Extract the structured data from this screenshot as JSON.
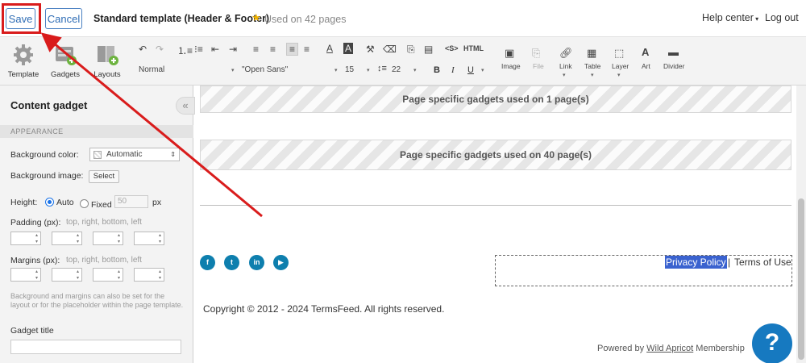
{
  "topbar": {
    "save_label": "Save",
    "cancel_label": "Cancel",
    "template_title": "Standard template (Header & Footer)",
    "used_on": "Used on 42 pages",
    "help_center": "Help center",
    "log_out": "Log out"
  },
  "toolbar": {
    "template": "Template",
    "gadgets": "Gadgets",
    "layouts": "Layouts",
    "format_value": "Normal",
    "font_value": "\"Open Sans\"",
    "font_size_value": "15",
    "line_height_value": "22",
    "source_label": "<S>",
    "html_label": "HTML",
    "image": "Image",
    "file": "File",
    "link": "Link",
    "table": "Table",
    "layer": "Layer",
    "art": "Art",
    "divider": "Divider"
  },
  "panel": {
    "title": "Content gadget",
    "section": "APPEARANCE",
    "bg_color_label": "Background color:",
    "bg_color_value": "Automatic",
    "bg_image_label": "Background image:",
    "select_label": "Select",
    "height_label": "Height:",
    "auto_label": "Auto",
    "fixed_label": "Fixed",
    "fixed_value": "50",
    "px_label": "px",
    "padding_label": "Padding (px):",
    "padding_hint": "top, right, bottom, left",
    "margins_label": "Margins (px):",
    "margins_hint": "top, right, bottom, left",
    "note": "Background and margins can also be set for the layout or for the placeholder within the page template.",
    "gadget_title_label": "Gadget title"
  },
  "canvas": {
    "strip1": "Page specific gadgets used on 1 page(s)",
    "strip2": "Page specific gadgets used on 40 page(s)",
    "privacy_policy": "Privacy Policy",
    "separator": "|",
    "terms_of_use": "Terms of Use",
    "copyright": "Copyright © 2012 - 2024 TermsFeed. All rights reserved.",
    "powered_prefix": "Powered by",
    "powered_link": "Wild Apricot",
    "powered_suffix": "Membership",
    "help_bubble": "?"
  },
  "colors": {
    "accent": "#2f6db5",
    "annotation": "#d91c1c",
    "social": "#0e7fae",
    "selection": "#3a62cf"
  }
}
